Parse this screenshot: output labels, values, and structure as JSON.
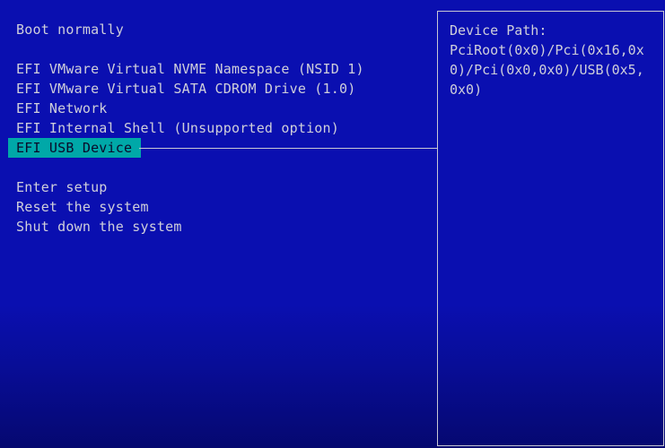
{
  "boot_menu": {
    "items": [
      {
        "label": "Boot normally"
      },
      {
        "label": "EFI VMware Virtual NVME Namespace (NSID 1)"
      },
      {
        "label": "EFI VMware Virtual SATA CDROM Drive (1.0)"
      },
      {
        "label": "EFI Network"
      },
      {
        "label": "EFI Internal Shell (Unsupported option)"
      },
      {
        "label": "EFI USB Device",
        "selected": true
      },
      {
        "label": "Enter setup"
      },
      {
        "label": "Reset the system"
      },
      {
        "label": "Shut down the system"
      }
    ]
  },
  "info_panel": {
    "heading": "Device Path:",
    "path_lines": [
      "PciRoot(0x0)/Pci(0x16,0x",
      "0)/Pci(0x0,0x0)/USB(0x5,",
      "0x0)"
    ]
  },
  "colors": {
    "background": "#0a0fb0",
    "text": "#cfcfda",
    "highlight": "#00a8a8"
  }
}
